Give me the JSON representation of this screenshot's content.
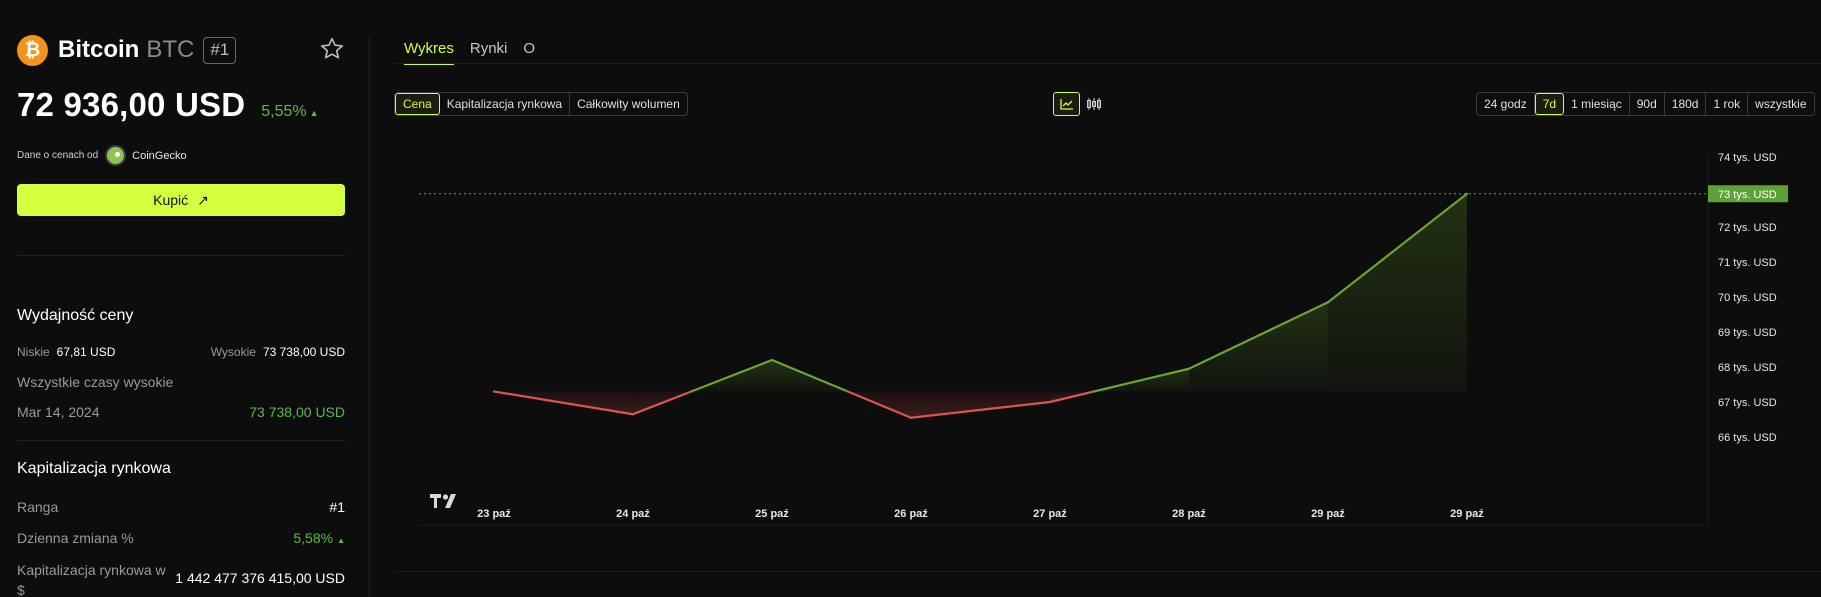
{
  "coin": {
    "name": "Bitcoin",
    "symbol": "BTC",
    "rank_badge": "#1",
    "logo_glyph": "₿",
    "price": "72 936,00 USD",
    "change": "5,55%",
    "source_label": "Dane o cenach od",
    "source_name": "CoinGecko",
    "buy_label": "Kupić",
    "buy_icon": "↗"
  },
  "performance": {
    "title": "Wydajność ceny",
    "low_label": "Niskie",
    "low_value": "67,81 USD",
    "high_label": "Wysokie",
    "high_value": "73 738,00 USD",
    "ath_label": "Wszystkie czasy wysokie",
    "ath_date": "Mar 14, 2024",
    "ath_value": "73 738,00 USD"
  },
  "market": {
    "title": "Kapitalizacja rynkowa",
    "rank_label": "Ranga",
    "rank_value": "#1",
    "daily_change_label": "Dzienna zmiana %",
    "daily_change_value": "5,58%",
    "cap_label_line1": "Kapitalizacja rynkowa w",
    "cap_label_line2": "$",
    "cap_value": "1 442 477 376 415,00 USD"
  },
  "tabs": [
    "Wykres",
    "Rynki",
    "O"
  ],
  "metrics": [
    "Cena",
    "Kapitalizacja rynkowa",
    "Całkowity wolumen"
  ],
  "ranges": [
    "24 godz",
    "7d",
    "1 miesiąc",
    "90d",
    "180d",
    "1 rok",
    "wszystkie"
  ],
  "active_range": "7d",
  "colors": {
    "accent": "#d4ff3f",
    "up": "#6aa436",
    "down": "#d9564f",
    "price_tag": "#5ea135"
  },
  "chart_data": {
    "type": "line",
    "x": [
      "23 paź",
      "24 paź",
      "25 paź",
      "26 paź",
      "27 paź",
      "28 paź",
      "29 paź",
      "29 paź"
    ],
    "values": [
      67.3,
      66.65,
      68.2,
      66.55,
      67.0,
      67.95,
      69.85,
      72.95
    ],
    "baseline": 67.3,
    "y_ticks": [
      "74 tys. USD",
      "73 tys. USD",
      "72 tys. USD",
      "71 tys. USD",
      "70 tys. USD",
      "69 tys. USD",
      "68 tys. USD",
      "67 tys. USD",
      "66 tys. USD"
    ],
    "y_tick_values": [
      74,
      73,
      72,
      71,
      70,
      69,
      68,
      67,
      66
    ],
    "current_label": "73 tys. USD",
    "current_value": 72.95,
    "unit": "tys. USD"
  }
}
